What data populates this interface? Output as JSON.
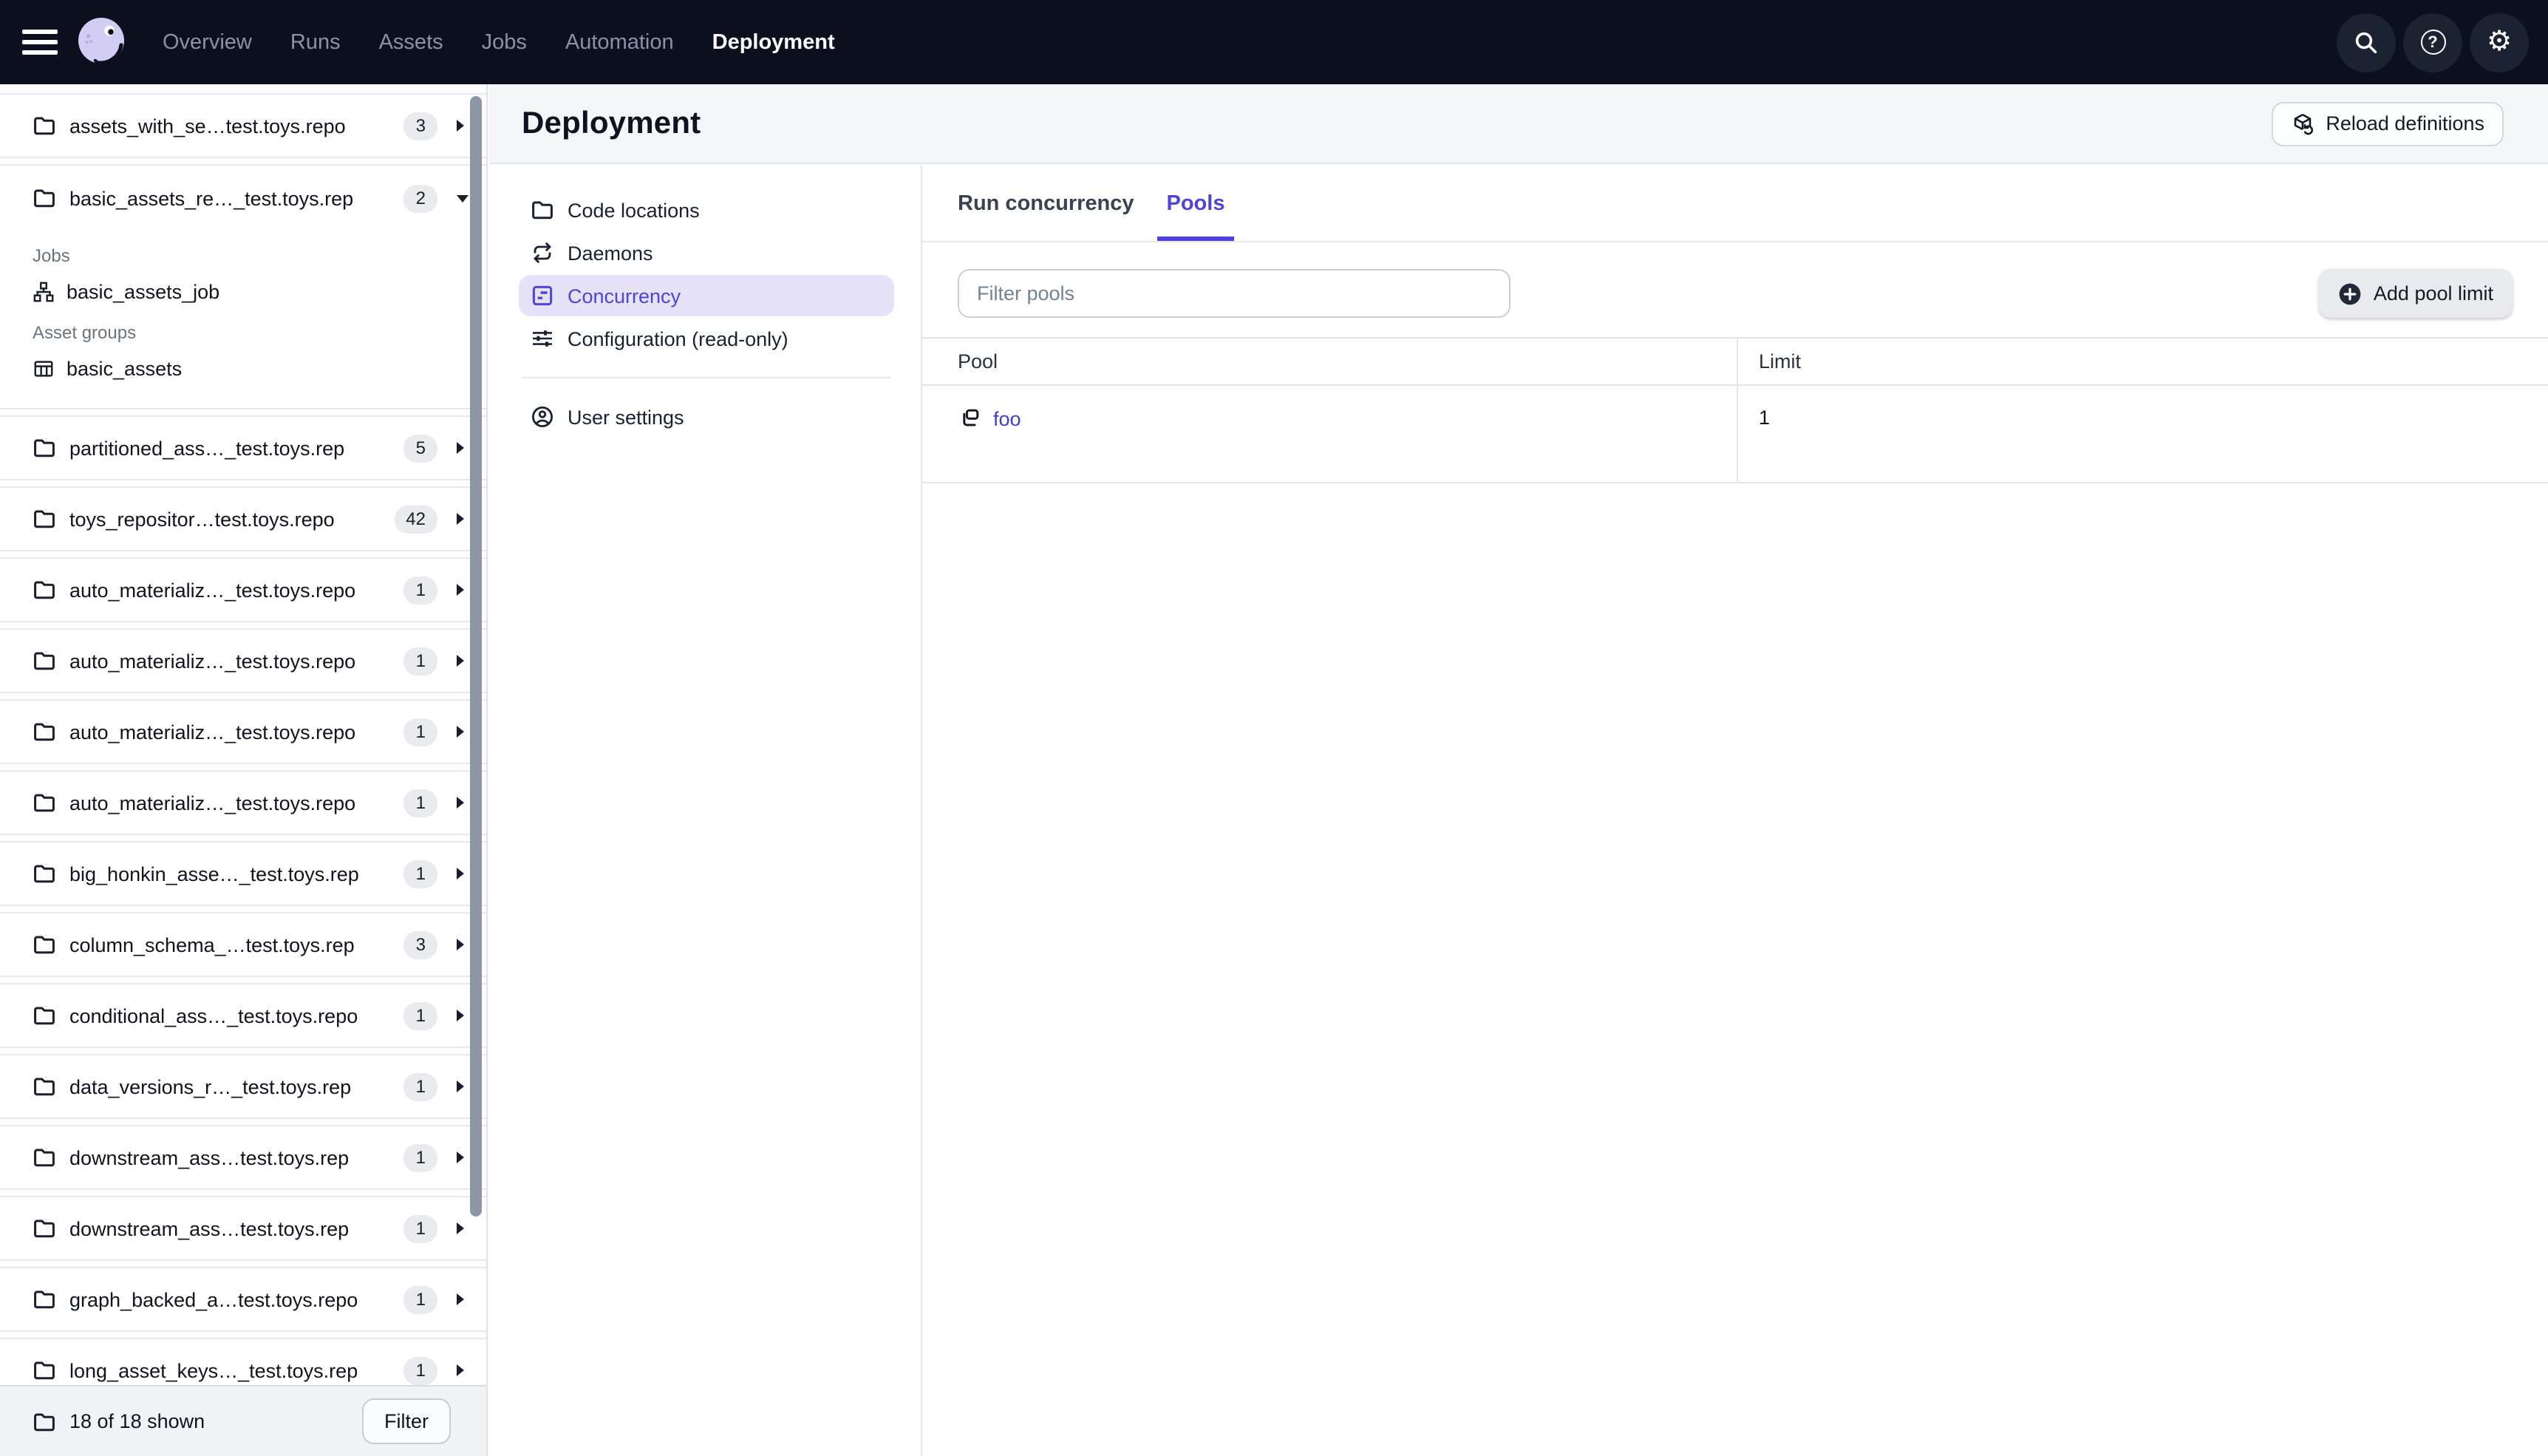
{
  "colors": {
    "accent": "#4F43DD",
    "navbar_bg": "#0B0F1E",
    "selected_nav_bg": "#E6E2F8",
    "link": "#423EC8",
    "logo_lavender": "#D3CDF4"
  },
  "topnav": {
    "items": [
      {
        "label": "Overview"
      },
      {
        "label": "Runs"
      },
      {
        "label": "Assets"
      },
      {
        "label": "Jobs"
      },
      {
        "label": "Automation"
      },
      {
        "label": "Deployment"
      }
    ],
    "active_item": "Deployment",
    "help_glyph": "?",
    "gear_glyph": "⚙"
  },
  "sidebar": {
    "rows": [
      {
        "label": "assets_with_se…test.toys.repo",
        "count": "3"
      },
      {
        "label": "basic_assets_re…_test.toys.rep",
        "count": "2",
        "expanded": true,
        "sections": [
          {
            "title": "Jobs",
            "items": [
              {
                "label": "basic_assets_job"
              }
            ]
          },
          {
            "title": "Asset groups",
            "items": [
              {
                "label": "basic_assets"
              }
            ]
          }
        ]
      },
      {
        "label": "partitioned_ass…_test.toys.rep",
        "count": "5"
      },
      {
        "label": "toys_repositor…test.toys.repo",
        "count": "42"
      },
      {
        "label": "auto_materializ…_test.toys.repo",
        "count": "1"
      },
      {
        "label": "auto_materializ…_test.toys.repo",
        "count": "1"
      },
      {
        "label": "auto_materializ…_test.toys.repo",
        "count": "1"
      },
      {
        "label": "auto_materializ…_test.toys.repo",
        "count": "1"
      },
      {
        "label": "big_honkin_asse…_test.toys.rep",
        "count": "1"
      },
      {
        "label": "column_schema_…test.toys.rep",
        "count": "3"
      },
      {
        "label": "conditional_ass…_test.toys.repo",
        "count": "1"
      },
      {
        "label": "data_versions_r…_test.toys.rep",
        "count": "1"
      },
      {
        "label": "downstream_ass…test.toys.rep",
        "count": "1"
      },
      {
        "label": "downstream_ass…test.toys.rep",
        "count": "1"
      },
      {
        "label": "graph_backed_a…test.toys.repo",
        "count": "1"
      },
      {
        "label": "long_asset_keys…_test.toys.rep",
        "count": "1"
      }
    ],
    "footer": {
      "summary": "18 of 18 shown",
      "filter_label": "Filter"
    }
  },
  "main": {
    "title": "Deployment",
    "reload_label": "Reload definitions",
    "subnav": [
      {
        "label": "Code locations"
      },
      {
        "label": "Daemons"
      },
      {
        "label": "Concurrency"
      },
      {
        "label": "Configuration (read-only)"
      }
    ],
    "selected_subnav": "Concurrency",
    "user_settings_label": "User settings",
    "tabs": [
      {
        "label": "Run concurrency"
      },
      {
        "label": "Pools"
      }
    ],
    "active_tab": "Pools",
    "filter_placeholder": "Filter pools",
    "add_button_label": "Add pool limit",
    "table": {
      "columns": [
        "Pool",
        "Limit"
      ],
      "rows": [
        {
          "pool": "foo",
          "limit": "1"
        }
      ]
    }
  }
}
